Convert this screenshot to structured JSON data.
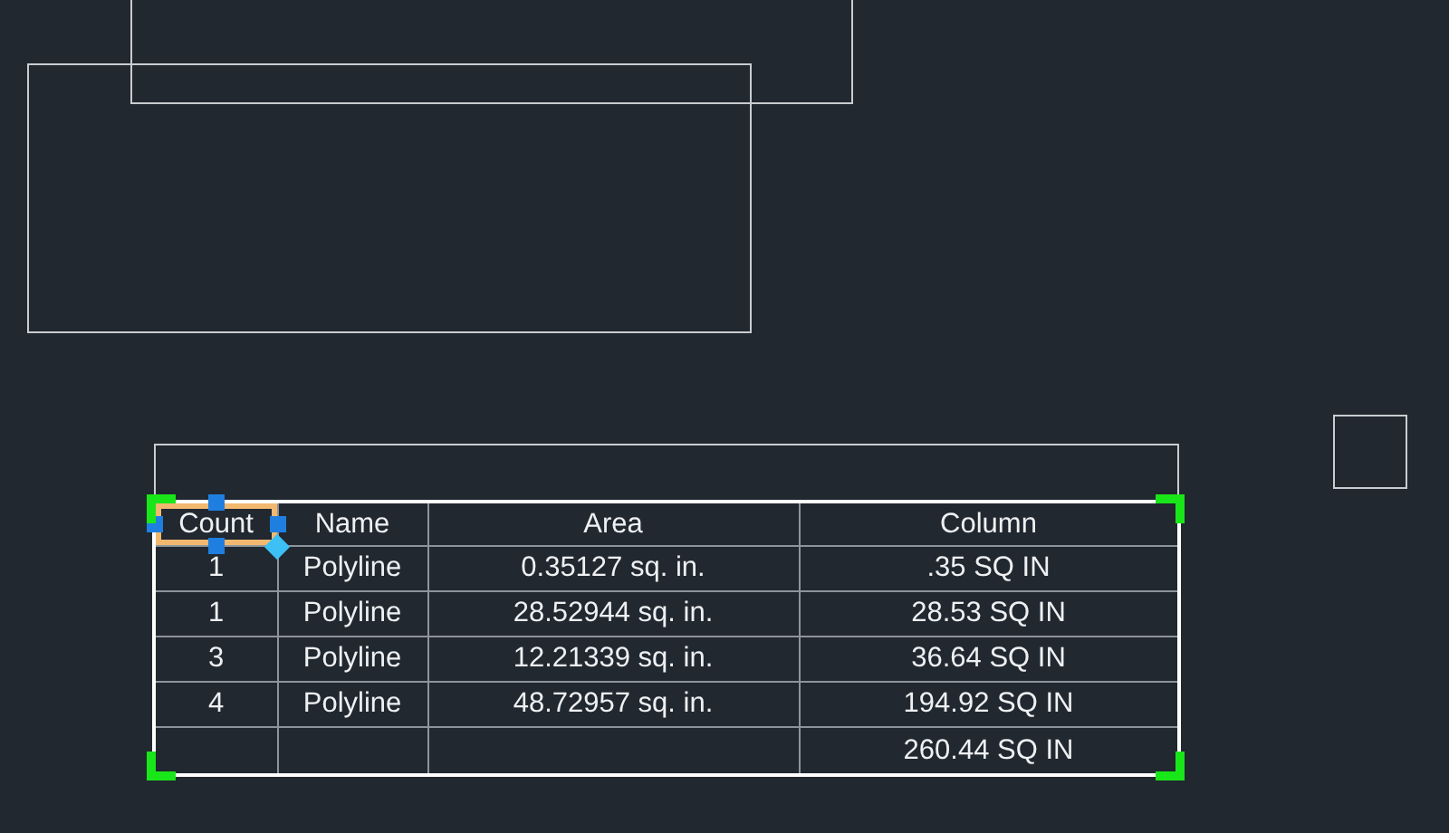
{
  "table": {
    "columns": [
      {
        "label": "Count",
        "selected": true
      },
      {
        "label": "Name",
        "selected": false
      },
      {
        "label": "Area",
        "selected": false
      },
      {
        "label": "Column",
        "selected": false
      }
    ],
    "rows": [
      {
        "count": "1",
        "name": "Polyline",
        "area": "0.35127 sq. in.",
        "column": ".35 SQ IN"
      },
      {
        "count": "1",
        "name": "Polyline",
        "area": "28.52944 sq. in.",
        "column": "28.53 SQ IN"
      },
      {
        "count": "3",
        "name": "Polyline",
        "area": "12.21339 sq. in.",
        "column": "36.64 SQ IN"
      },
      {
        "count": "4",
        "name": "Polyline",
        "area": "48.72957 sq. in.",
        "column": "194.92 SQ IN"
      },
      {
        "column": "260.44 SQ IN"
      }
    ]
  }
}
